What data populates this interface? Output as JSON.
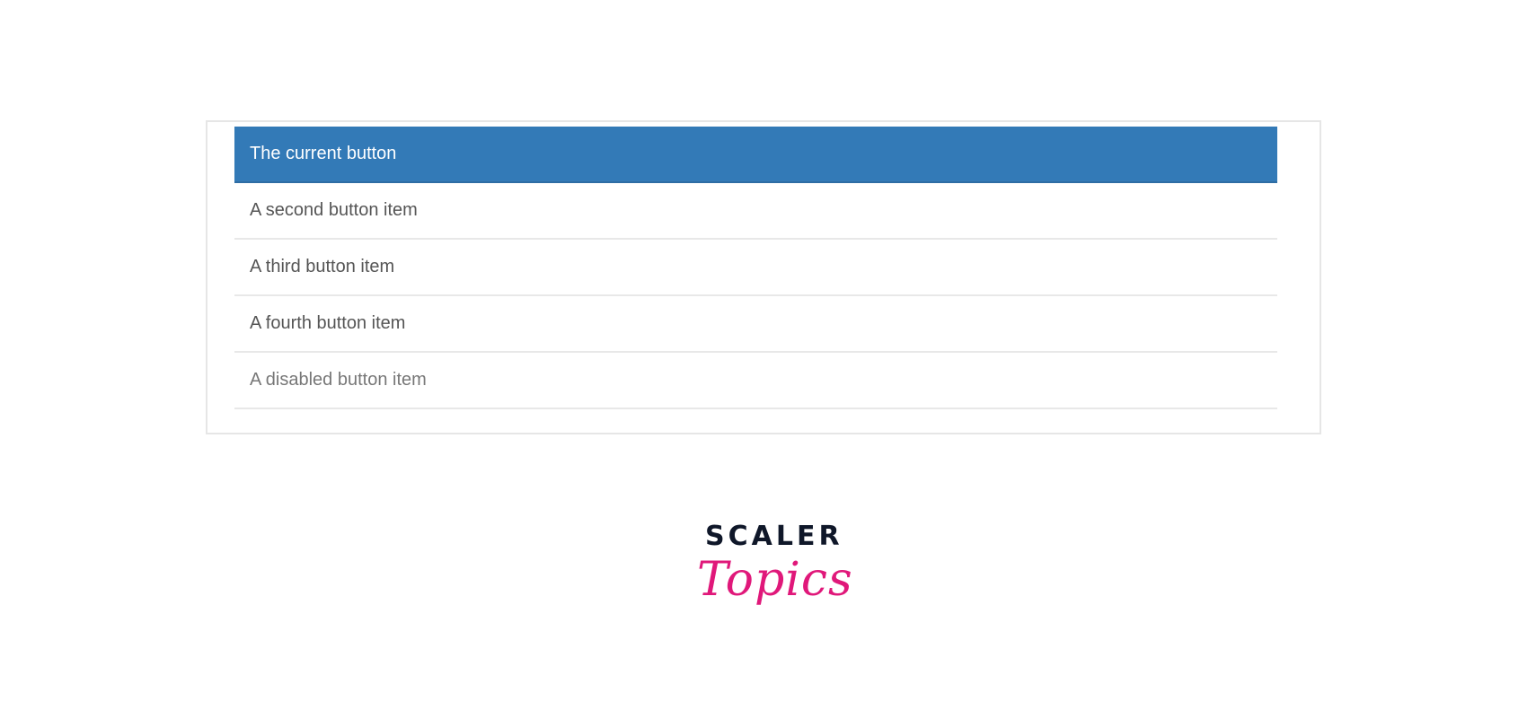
{
  "list": {
    "items": [
      {
        "label": "The current button",
        "state": "active"
      },
      {
        "label": "A second button item",
        "state": "default"
      },
      {
        "label": "A third button item",
        "state": "default"
      },
      {
        "label": "A fourth button item",
        "state": "default"
      },
      {
        "label": "A disabled button item",
        "state": "disabled"
      }
    ]
  },
  "logo": {
    "brand": "SCALER",
    "product": "Topics",
    "brand_color": "#0f1729",
    "product_color": "#e0187a"
  },
  "colors": {
    "active_background": "#337ab7",
    "active_text": "#ffffff",
    "item_text": "#555555"
  }
}
